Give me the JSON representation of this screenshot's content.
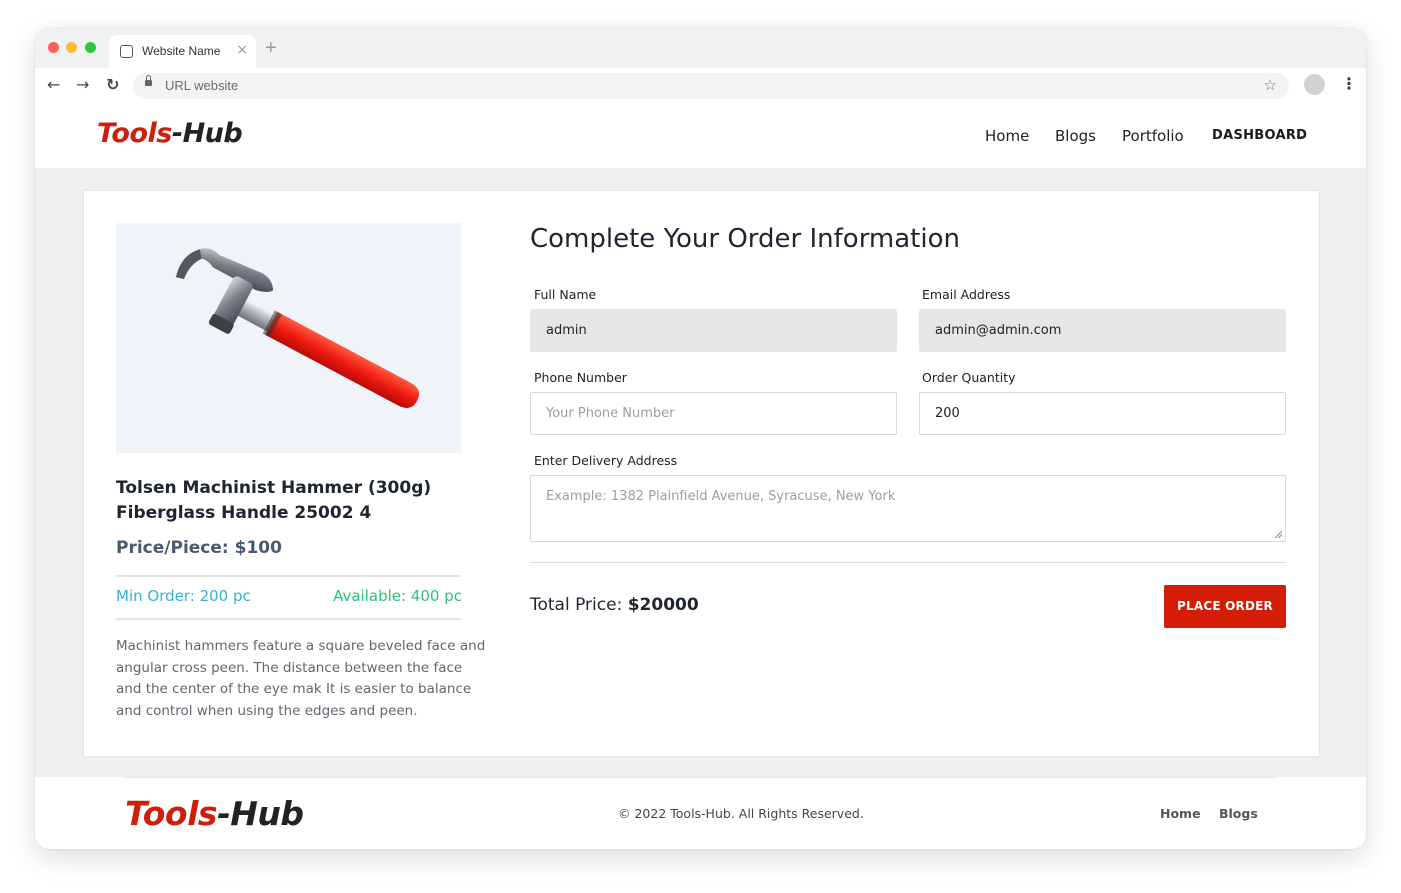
{
  "browser": {
    "tab_title": "Website Name",
    "url_placeholder": "URL website",
    "colors": {
      "close": "#ff5f57",
      "minimize": "#febc2e",
      "maximize": "#28c840"
    }
  },
  "header": {
    "logo_part1": "Tools",
    "logo_part2": "-Hub",
    "nav": {
      "home": "Home",
      "blogs": "Blogs",
      "portfolio": "Portfolio",
      "dashboard": "DASHBOARD"
    }
  },
  "product": {
    "title": "Tolsen Machinist Hammer (300g) Fiberglass Handle 25002 4",
    "price": "Price/Piece: $100",
    "min_order": "Min Order: 200 pc",
    "available": "Available: 400 pc",
    "description": "Machinist hammers feature a square beveled face and angular cross peen. The distance between the face and the center of the eye mak It is easier to balance and control when using the edges and peen.",
    "image_icon": "hammer-image"
  },
  "form": {
    "title": "Complete Your Order Information",
    "full_name_label": "Full Name",
    "full_name_value": "admin",
    "email_label": "Email Address",
    "email_value": "admin@admin.com",
    "phone_label": "Phone Number",
    "phone_placeholder": "Your Phone Number",
    "quantity_label": "Order Quantity",
    "quantity_value": "200",
    "address_label": "Enter Delivery Address",
    "address_placeholder": "Example: 1382 Plainfield Avenue, Syracuse, New York",
    "total_label": "Total Price:",
    "total_value": "$20000",
    "submit_label": "PLACE ORDER"
  },
  "footer": {
    "logo_part1": "Tools",
    "logo_part2": "-Hub",
    "copyright": "© 2022 Tools-Hub. All Rights Reserved.",
    "links": {
      "home": "Home",
      "blogs": "Blogs"
    }
  },
  "colors": {
    "brand_red": "#cc1f0c",
    "button_red": "#d41c06",
    "min_order": "#2fb3d9",
    "available": "#27c47a"
  }
}
